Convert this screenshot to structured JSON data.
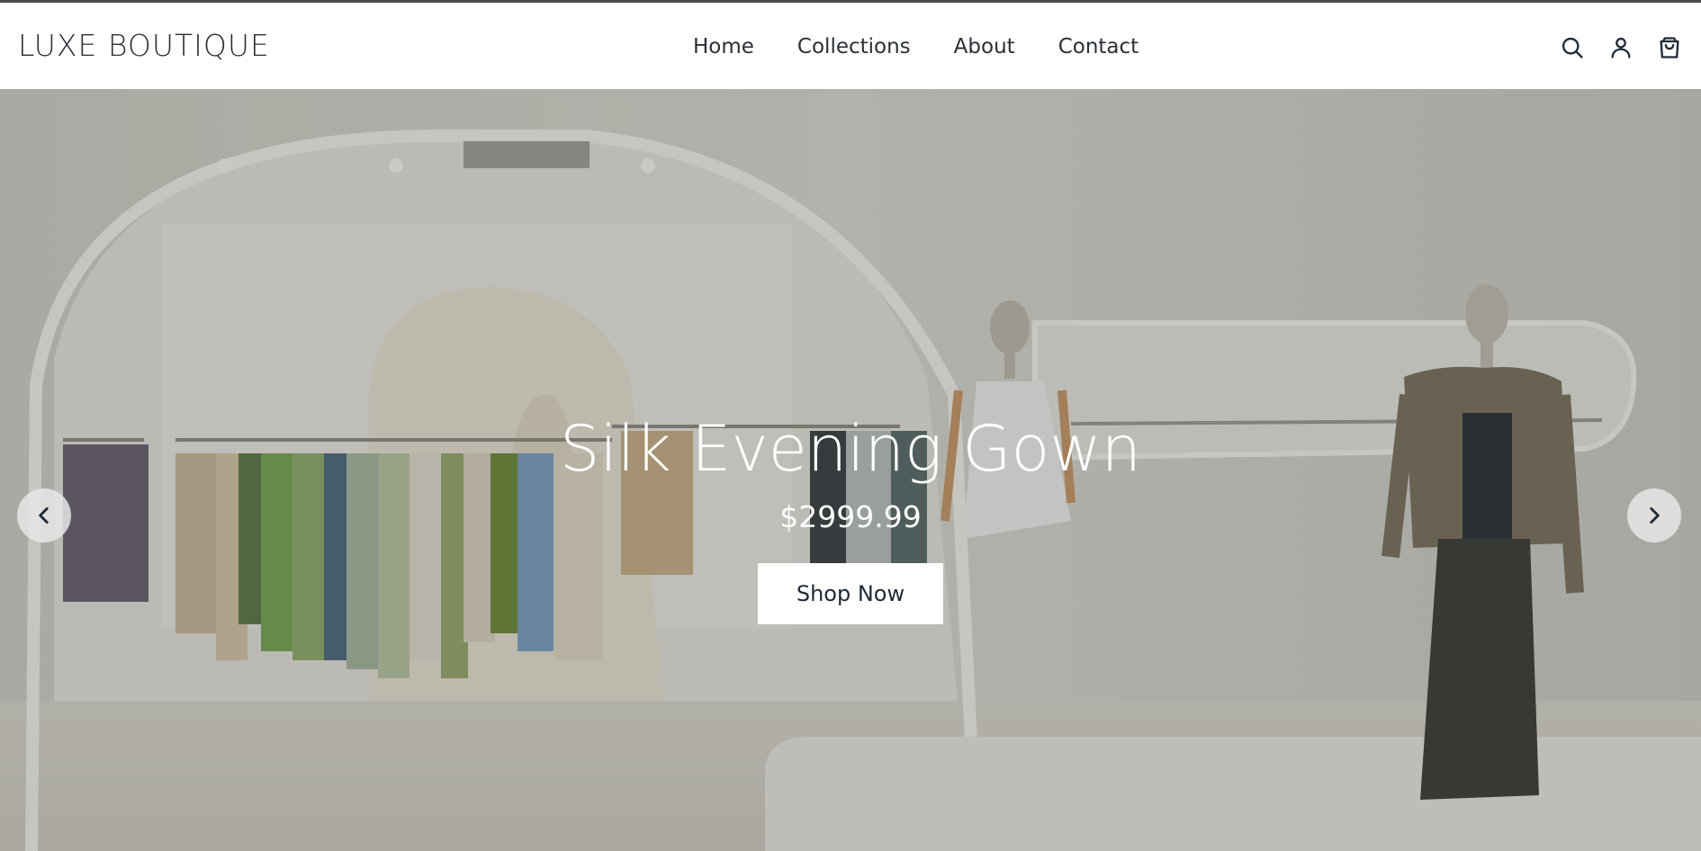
{
  "header": {
    "logo": "LUXE BOUTIQUE",
    "nav": [
      {
        "label": "Home"
      },
      {
        "label": "Collections"
      },
      {
        "label": "About"
      },
      {
        "label": "Contact"
      }
    ],
    "icons": [
      "search-icon",
      "user-icon",
      "shopping-bag-icon"
    ]
  },
  "hero": {
    "title": "Silk Evening Gown",
    "price": "$2999.99",
    "cta_label": "Shop Now",
    "prev_icon": "chevron-left-icon",
    "next_icon": "chevron-right-icon"
  },
  "colors": {
    "accent": "#ffffff",
    "text_dark": "#2b2f36",
    "top_rule": "#4b4b4b"
  }
}
